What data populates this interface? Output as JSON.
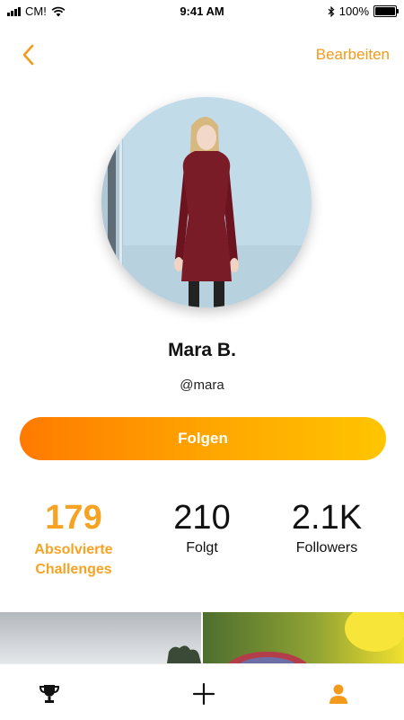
{
  "status_bar": {
    "carrier": "CM!",
    "time": "9:41 AM",
    "battery": "100%"
  },
  "nav": {
    "edit_label": "Bearbeiten"
  },
  "profile": {
    "name": "Mara B.",
    "handle": "@mara"
  },
  "follow_button": {
    "label": "Folgen"
  },
  "stats": [
    {
      "value": "179",
      "label_line1": "Absolvierte",
      "label_line2": "Challenges"
    },
    {
      "value": "210",
      "label": "Folgt"
    },
    {
      "value": "2.1K",
      "label": "Followers"
    }
  ],
  "colors": {
    "accent": "#f6a324",
    "gradient_start": "#ff7a00",
    "gradient_end": "#ffc500"
  },
  "tabs": [
    {
      "icon": "trophy-icon",
      "active": false
    },
    {
      "icon": "plus-icon",
      "active": false
    },
    {
      "icon": "person-icon",
      "active": true
    }
  ]
}
